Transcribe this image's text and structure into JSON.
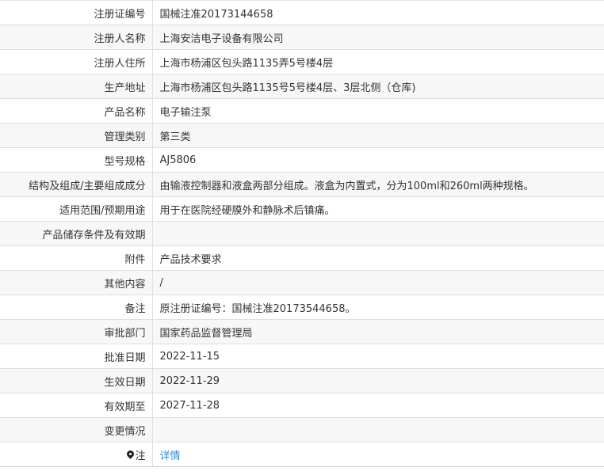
{
  "rows": [
    {
      "label": "注册证编号",
      "value": "国械注准20173144658"
    },
    {
      "label": "注册人名称",
      "value": "上海安洁电子设备有限公司"
    },
    {
      "label": "注册人住所",
      "value": "上海市杨浦区包头路1135弄5号楼4层"
    },
    {
      "label": "生产地址",
      "value": "上海市杨浦区包头路1135号5号楼4层、3层北侧（仓库)"
    },
    {
      "label": "产品名称",
      "value": "电子输注泵"
    },
    {
      "label": "管理类别",
      "value": "第三类"
    },
    {
      "label": "型号规格",
      "value": "AJ5806"
    },
    {
      "label": "结构及组成/主要组成成分",
      "value": "由输液控制器和液盒两部分组成。液盒为内置式，分为100ml和260ml两种规格。"
    },
    {
      "label": "适用范围/预期用途",
      "value": "用于在医院经硬膜外和静脉术后镇痛。"
    },
    {
      "label": "产品储存条件及有效期",
      "value": ""
    },
    {
      "label": "附件",
      "value": "产品技术要求"
    },
    {
      "label": "其他内容",
      "value": "/"
    },
    {
      "label": "备注",
      "value": "原注册证编号：国械注准20173544658。"
    },
    {
      "label": "审批部门",
      "value": "国家药品监督管理局"
    },
    {
      "label": "批准日期",
      "value": "2022-11-15"
    },
    {
      "label": "生效日期",
      "value": "2022-11-29"
    },
    {
      "label": "有效期至",
      "value": "2027-11-28"
    },
    {
      "label": "变更情况",
      "value": ""
    },
    {
      "label": "注",
      "value": "详情",
      "icon": "pin-icon"
    }
  ],
  "colors": {
    "link": "#2f8bd6",
    "row_alt": "#f7f7f7",
    "border": "#dedede"
  }
}
